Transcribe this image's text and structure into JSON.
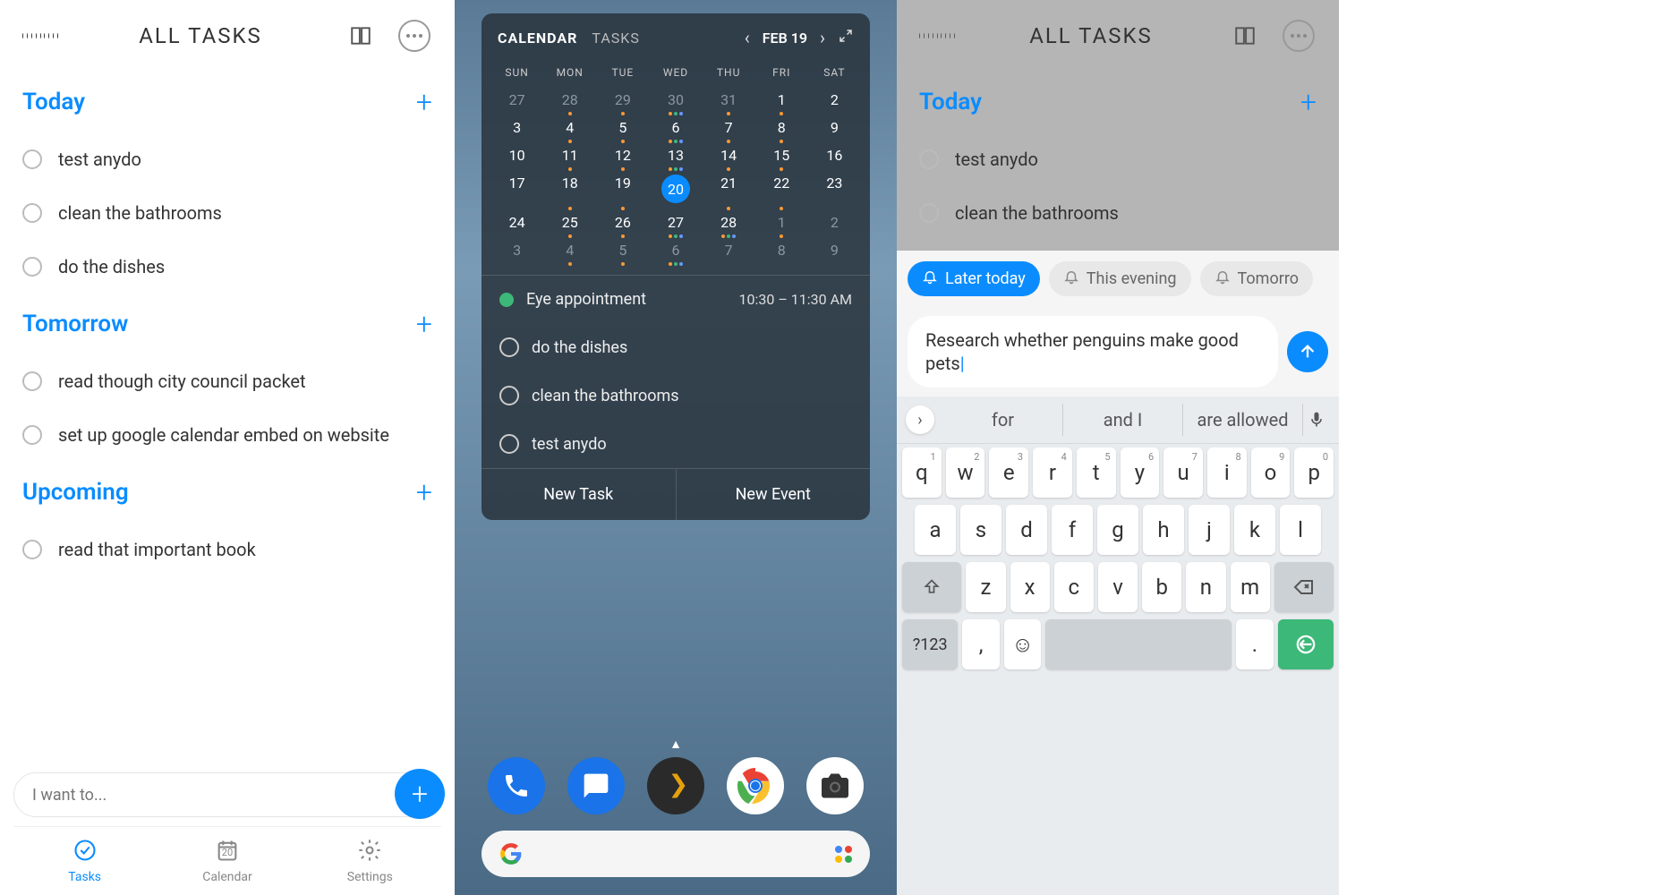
{
  "panel1": {
    "header_title": "ALL TASKS",
    "sections": [
      {
        "title": "Today",
        "tasks": [
          "test anydo",
          "clean the bathrooms",
          "do the dishes"
        ]
      },
      {
        "title": "Tomorrow",
        "tasks": [
          "read though city council packet",
          "set up google calendar embed on website"
        ]
      },
      {
        "title": "Upcoming",
        "tasks": [
          "read that important book"
        ]
      }
    ],
    "input_placeholder": "I want to...",
    "tabs": [
      {
        "label": "Tasks",
        "active": true
      },
      {
        "label": "Calendar",
        "date": "20"
      },
      {
        "label": "Settings"
      }
    ]
  },
  "panel2": {
    "widget_tabs": [
      "CALENDAR",
      "TASKS"
    ],
    "date_label": "FEB 19",
    "dow": [
      "SUN",
      "MON",
      "TUE",
      "WED",
      "THU",
      "FRI",
      "SAT"
    ],
    "weeks": [
      [
        {
          "d": "27",
          "f": true
        },
        {
          "d": "28",
          "f": true,
          "dots": [
            "o"
          ]
        },
        {
          "d": "29",
          "f": true,
          "dots": [
            "o"
          ]
        },
        {
          "d": "30",
          "f": true,
          "dots": [
            "o",
            "g",
            "b"
          ]
        },
        {
          "d": "31",
          "f": true,
          "dots": [
            "o"
          ]
        },
        {
          "d": "1",
          "dots": [
            "o"
          ]
        },
        {
          "d": "2"
        }
      ],
      [
        {
          "d": "3"
        },
        {
          "d": "4",
          "dots": [
            "o"
          ]
        },
        {
          "d": "5",
          "dots": [
            "o"
          ]
        },
        {
          "d": "6",
          "dots": [
            "o",
            "g",
            "b"
          ]
        },
        {
          "d": "7",
          "dots": [
            "o"
          ]
        },
        {
          "d": "8",
          "dots": [
            "o"
          ]
        },
        {
          "d": "9"
        }
      ],
      [
        {
          "d": "10"
        },
        {
          "d": "11",
          "dots": [
            "o"
          ]
        },
        {
          "d": "12",
          "dots": [
            "o"
          ]
        },
        {
          "d": "13",
          "dots": [
            "o",
            "g",
            "b"
          ]
        },
        {
          "d": "14",
          "dots": [
            "o"
          ]
        },
        {
          "d": "15",
          "dots": [
            "o"
          ]
        },
        {
          "d": "16"
        }
      ],
      [
        {
          "d": "17"
        },
        {
          "d": "18",
          "dots": [
            "o"
          ]
        },
        {
          "d": "19",
          "dots": [
            "o"
          ]
        },
        {
          "d": "20",
          "sel": true
        },
        {
          "d": "21",
          "dots": [
            "o"
          ]
        },
        {
          "d": "22",
          "dots": [
            "o"
          ]
        },
        {
          "d": "23"
        }
      ],
      [
        {
          "d": "24"
        },
        {
          "d": "25",
          "dots": [
            "o"
          ]
        },
        {
          "d": "26",
          "dots": [
            "o"
          ]
        },
        {
          "d": "27",
          "dots": [
            "o",
            "g",
            "b"
          ]
        },
        {
          "d": "28",
          "dots": [
            "o",
            "g",
            "b"
          ]
        },
        {
          "d": "1",
          "f": true,
          "dots": [
            "o"
          ]
        },
        {
          "d": "2",
          "f": true
        }
      ],
      [
        {
          "d": "3",
          "f": true
        },
        {
          "d": "4",
          "f": true,
          "dots": [
            "o"
          ]
        },
        {
          "d": "5",
          "f": true,
          "dots": [
            "o"
          ]
        },
        {
          "d": "6",
          "f": true,
          "dots": [
            "o",
            "g",
            "b"
          ]
        },
        {
          "d": "7",
          "f": true
        },
        {
          "d": "8",
          "f": true
        },
        {
          "d": "9",
          "f": true
        }
      ]
    ],
    "events": [
      {
        "type": "appt",
        "label": "Eye appointment",
        "time": "10:30 – 11:30 AM"
      },
      {
        "type": "task",
        "label": "do the dishes"
      },
      {
        "type": "task",
        "label": "clean the bathrooms"
      },
      {
        "type": "task",
        "label": "test anydo"
      }
    ],
    "actions": [
      "New Task",
      "New Event"
    ],
    "dock_apps": [
      "phone",
      "messages",
      "plex",
      "chrome",
      "camera"
    ]
  },
  "panel3": {
    "header_title": "ALL TASKS",
    "section_title": "Today",
    "tasks": [
      "test anydo",
      "clean the bathrooms"
    ],
    "chips": [
      {
        "label": "Later today",
        "active": true
      },
      {
        "label": "This evening",
        "active": false
      },
      {
        "label": "Tomorro",
        "active": false
      }
    ],
    "task_input_text": "Research whether penguins make good pets",
    "suggestions": [
      "for",
      "and I",
      "are allowed"
    ],
    "keyboard": {
      "row1": [
        [
          "q",
          "1"
        ],
        [
          "w",
          "2"
        ],
        [
          "e",
          "3"
        ],
        [
          "r",
          "4"
        ],
        [
          "t",
          "5"
        ],
        [
          "y",
          "6"
        ],
        [
          "u",
          "7"
        ],
        [
          "i",
          "8"
        ],
        [
          "o",
          "9"
        ],
        [
          "p",
          "0"
        ]
      ],
      "row2": [
        "a",
        "s",
        "d",
        "f",
        "g",
        "h",
        "j",
        "k",
        "l"
      ],
      "row3": [
        "z",
        "x",
        "c",
        "v",
        "b",
        "n",
        "m"
      ],
      "sym_key": "?123",
      "comma": ",",
      "period": "."
    }
  }
}
